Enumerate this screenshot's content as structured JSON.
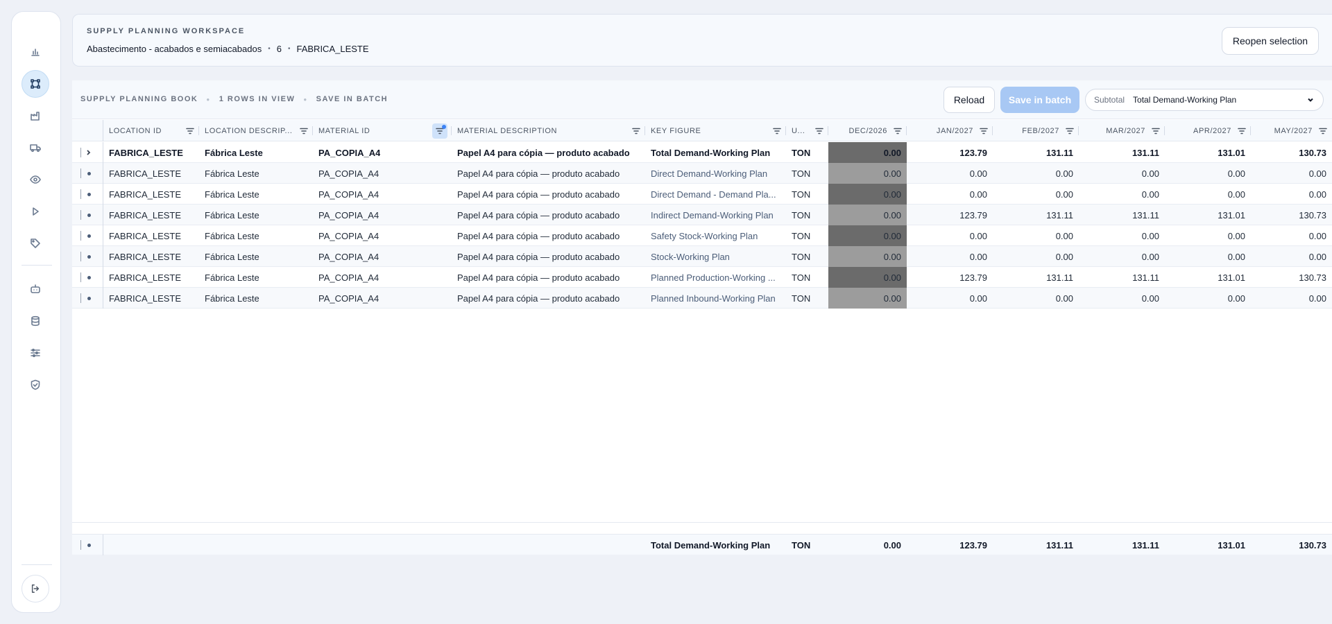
{
  "sidebar": {
    "items": [
      {
        "icon": "bar-chart-icon",
        "active": false
      },
      {
        "icon": "workflow-icon",
        "active": true
      },
      {
        "icon": "factory-icon",
        "active": false
      },
      {
        "icon": "truck-icon",
        "active": false
      },
      {
        "icon": "eye-icon",
        "active": false
      },
      {
        "icon": "play-icon",
        "active": false
      },
      {
        "icon": "tag-icon",
        "active": false
      },
      {
        "icon": "robot-icon",
        "active": false
      },
      {
        "icon": "database-icon",
        "active": false
      },
      {
        "icon": "sliders-icon",
        "active": false
      },
      {
        "icon": "shield-check-icon",
        "active": false
      }
    ],
    "logout_icon": "logout-icon"
  },
  "header": {
    "title": "SUPPLY PLANNING WORKSPACE",
    "scope": "Abastecimento - acabados e semiacabados",
    "count": "6",
    "location": "FABRICA_LESTE",
    "reopen_label": "Reopen selection"
  },
  "toolbar": {
    "book_label": "SUPPLY PLANNING BOOK",
    "rows_label": "1 ROWS IN VIEW",
    "mode_label": "SAVE IN BATCH",
    "reload_label": "Reload",
    "save_label": "Save in batch",
    "subtotal_label": "Subtotal",
    "subtotal_value": "Total Demand-Working Plan"
  },
  "columns": [
    {
      "key": "location_id",
      "label": "LOCATION ID"
    },
    {
      "key": "location_desc",
      "label": "LOCATION DESCRIP..."
    },
    {
      "key": "material_id",
      "label": "MATERIAL ID",
      "filter_active": true
    },
    {
      "key": "material_desc",
      "label": "MATERIAL DESCRIPTION"
    },
    {
      "key": "key_figure",
      "label": "KEY FIGURE"
    },
    {
      "key": "uom",
      "label": "U..."
    },
    {
      "key": "dec2026",
      "label": "DEC/2026"
    },
    {
      "key": "jan2027",
      "label": "JAN/2027"
    },
    {
      "key": "feb2027",
      "label": "FEB/2027"
    },
    {
      "key": "mar2027",
      "label": "MAR/2027"
    },
    {
      "key": "apr2027",
      "label": "APR/2027"
    },
    {
      "key": "may2027",
      "label": "MAY/2027"
    }
  ],
  "rows": [
    {
      "location_id": "FABRICA_LESTE",
      "location_desc": "Fábrica Leste",
      "material_id": "PA_COPIA_A4",
      "material_desc": "Papel A4 para cópia — produto acabado",
      "key_figure": "Total Demand-Working Plan",
      "uom": "TON",
      "dec2026": "0.00",
      "jan2027": "123.79",
      "feb2027": "131.11",
      "mar2027": "131.11",
      "apr2027": "131.01",
      "may2027": "130.73",
      "bold": true,
      "expandable": true,
      "dec_shade": "dark"
    },
    {
      "location_id": "FABRICA_LESTE",
      "location_desc": "Fábrica Leste",
      "material_id": "PA_COPIA_A4",
      "material_desc": "Papel A4 para cópia — produto acabado",
      "key_figure": "Direct Demand-Working Plan",
      "uom": "TON",
      "dec2026": "0.00",
      "jan2027": "0.00",
      "feb2027": "0.00",
      "mar2027": "0.00",
      "apr2027": "0.00",
      "may2027": "0.00",
      "dec_shade": "light"
    },
    {
      "location_id": "FABRICA_LESTE",
      "location_desc": "Fábrica Leste",
      "material_id": "PA_COPIA_A4",
      "material_desc": "Papel A4 para cópia — produto acabado",
      "key_figure": "Direct Demand - Demand Pla...",
      "uom": "TON",
      "dec2026": "0.00",
      "jan2027": "0.00",
      "feb2027": "0.00",
      "mar2027": "0.00",
      "apr2027": "0.00",
      "may2027": "0.00",
      "dec_shade": "dark"
    },
    {
      "location_id": "FABRICA_LESTE",
      "location_desc": "Fábrica Leste",
      "material_id": "PA_COPIA_A4",
      "material_desc": "Papel A4 para cópia — produto acabado",
      "key_figure": "Indirect Demand-Working Plan",
      "uom": "TON",
      "dec2026": "0.00",
      "jan2027": "123.79",
      "feb2027": "131.11",
      "mar2027": "131.11",
      "apr2027": "131.01",
      "may2027": "130.73",
      "dec_shade": "light"
    },
    {
      "location_id": "FABRICA_LESTE",
      "location_desc": "Fábrica Leste",
      "material_id": "PA_COPIA_A4",
      "material_desc": "Papel A4 para cópia — produto acabado",
      "key_figure": "Safety Stock-Working Plan",
      "uom": "TON",
      "dec2026": "0.00",
      "jan2027": "0.00",
      "feb2027": "0.00",
      "mar2027": "0.00",
      "apr2027": "0.00",
      "may2027": "0.00",
      "dec_shade": "dark"
    },
    {
      "location_id": "FABRICA_LESTE",
      "location_desc": "Fábrica Leste",
      "material_id": "PA_COPIA_A4",
      "material_desc": "Papel A4 para cópia — produto acabado",
      "key_figure": "Stock-Working Plan",
      "uom": "TON",
      "dec2026": "0.00",
      "jan2027": "0.00",
      "feb2027": "0.00",
      "mar2027": "0.00",
      "apr2027": "0.00",
      "may2027": "0.00",
      "dec_shade": "light"
    },
    {
      "location_id": "FABRICA_LESTE",
      "location_desc": "Fábrica Leste",
      "material_id": "PA_COPIA_A4",
      "material_desc": "Papel A4 para cópia — produto acabado",
      "key_figure": "Planned Production-Working ...",
      "uom": "TON",
      "dec2026": "0.00",
      "jan2027": "123.79",
      "feb2027": "131.11",
      "mar2027": "131.11",
      "apr2027": "131.01",
      "may2027": "130.73",
      "dec_shade": "dark"
    },
    {
      "location_id": "FABRICA_LESTE",
      "location_desc": "Fábrica Leste",
      "material_id": "PA_COPIA_A4",
      "material_desc": "Papel A4 para cópia — produto acabado",
      "key_figure": "Planned Inbound-Working Plan",
      "uom": "TON",
      "dec2026": "0.00",
      "jan2027": "0.00",
      "feb2027": "0.00",
      "mar2027": "0.00",
      "apr2027": "0.00",
      "may2027": "0.00",
      "dec_shade": "light"
    }
  ],
  "footer": {
    "key_figure": "Total Demand-Working Plan",
    "uom": "TON",
    "dec2026": "0.00",
    "jan2027": "123.79",
    "feb2027": "131.11",
    "mar2027": "131.11",
    "apr2027": "131.01",
    "may2027": "130.73"
  },
  "colors": {
    "accent": "#a8c8f4",
    "dec_dark": "#6b6b6b",
    "dec_light": "#9c9c9c"
  }
}
